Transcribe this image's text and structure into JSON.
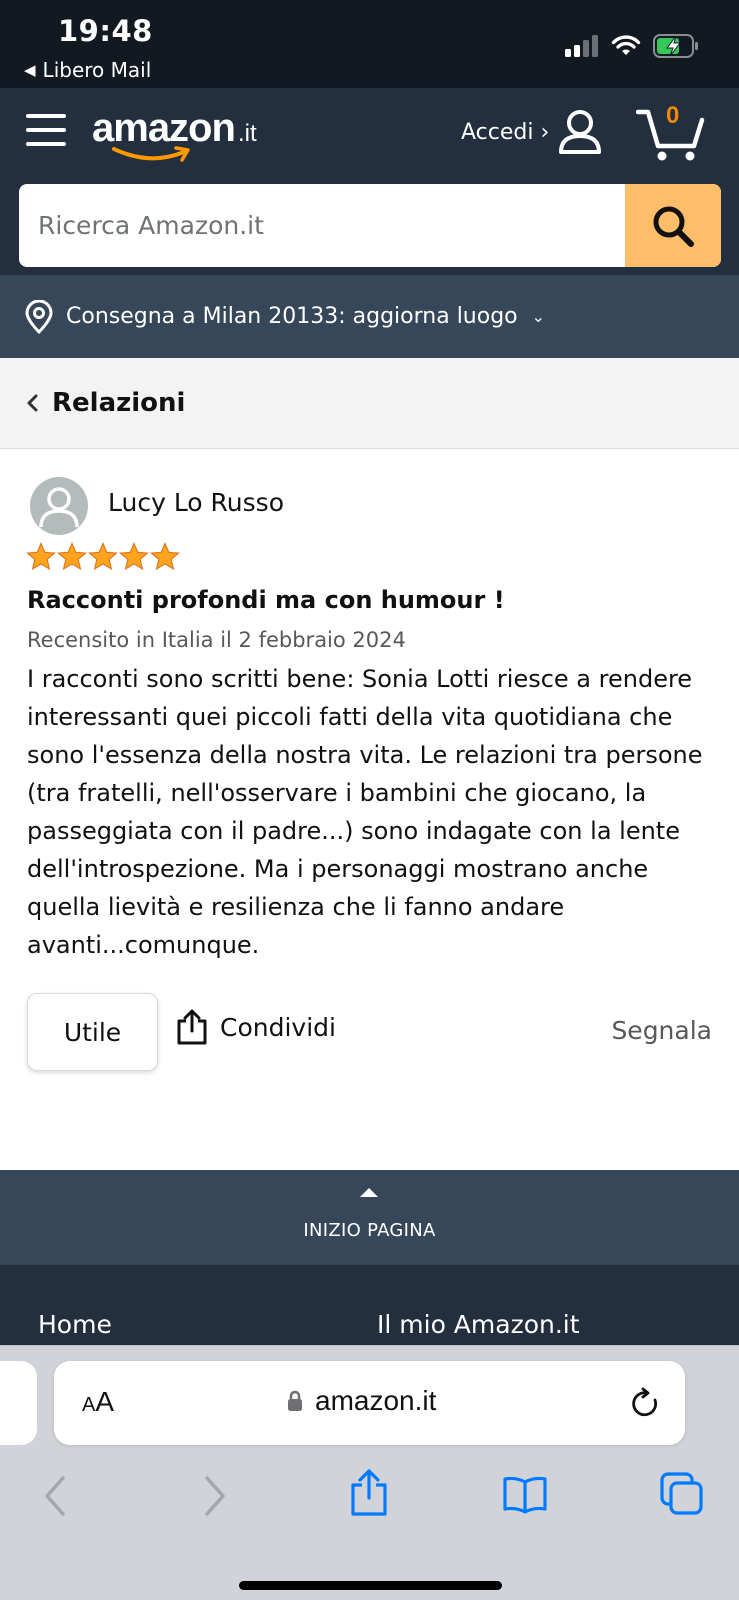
{
  "status_bar": {
    "time": "19:48",
    "back_app": "Libero Mail"
  },
  "header": {
    "logo_text": "amazon",
    "logo_tld": ".it",
    "sign_in": "Accedi ›",
    "cart_count": "0"
  },
  "search": {
    "placeholder": "Ricerca Amazon.it",
    "value": ""
  },
  "delivery": {
    "text": "Consegna a Milan 20133: aggiorna luogo"
  },
  "breadcrumb": {
    "label": "Relazioni"
  },
  "review": {
    "reviewer": "Lucy Lo Russo",
    "rating": 5,
    "rating_max": 5,
    "title": "Racconti profondi ma con humour !",
    "date": "Recensito in Italia il 2 febbraio 2024",
    "body": "I racconti sono scritti bene: Sonia Lotti riesce a rendere interessanti quei piccoli fatti della vita quotidiana che sono l'essenza della nostra vita. Le relazioni tra persone (tra fratelli, nell'osservare i bambini che giocano, la passeggiata con il padre...) sono indagate con la lente dell'introspezione. Ma i personaggi mostrano anche quella lievità e resilienza che li fanno andare avanti...comunque.",
    "helpful_label": "Utile",
    "share_label": "Condividi",
    "report_label": "Segnala"
  },
  "back_to_top": {
    "label": "INIZIO PAGINA"
  },
  "footer": {
    "links": [
      "Home",
      "Il mio Amazon.it"
    ]
  },
  "browser": {
    "aa_small": "A",
    "aa_big": "A",
    "url": "amazon.it"
  },
  "colors": {
    "nav_dark": "#232f3e",
    "status_dark": "#131921",
    "sub_nav": "#37475a",
    "search_button": "#febd69",
    "star": "#ffa41c",
    "cart_count": "#f08804",
    "safari_blue": "#007aff"
  }
}
